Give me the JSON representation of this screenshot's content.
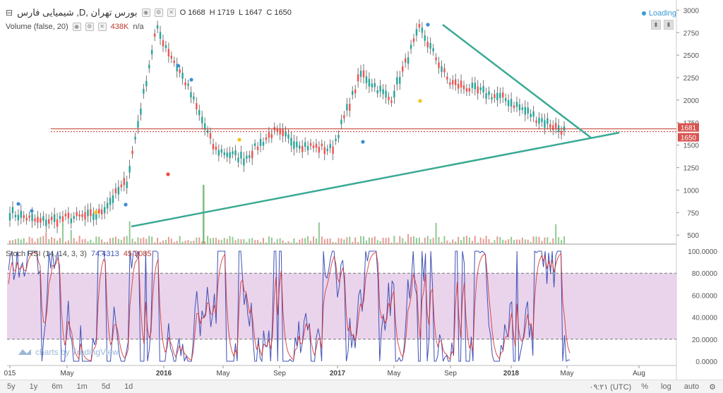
{
  "legend": {
    "symbol": "⊟",
    "title": "شیمیایی فارس ,D, بورس تهران",
    "open": "O 1668",
    "high": "H 1719",
    "low": "L 1647",
    "close": "C 1650"
  },
  "volume_legend": {
    "label": "Volume (false, 20)",
    "value": "438K",
    "na": "n/a"
  },
  "rsi_legend": {
    "label": "Stoch RSI (14, 14, 3, 3)",
    "k": "74.4313",
    "d": "45.3085"
  },
  "status": {
    "loading": "Loading"
  },
  "price_axis": {
    "ticks": [
      "3000",
      "2750",
      "2500",
      "2250",
      "2000",
      "1750",
      "1500",
      "1250",
      "1000",
      "750",
      "500"
    ],
    "badge_high": "1681",
    "badge_close": "1650"
  },
  "rsi_axis": {
    "ticks": [
      "100.0000",
      "80.0000",
      "60.0000",
      "40.0000",
      "20.0000",
      "0.0000"
    ]
  },
  "time_axis": {
    "labels": [
      "015",
      "May",
      "2016",
      "May",
      "Sep",
      "2017",
      "May",
      "Sep",
      "2018",
      "May",
      "Aug"
    ]
  },
  "bottom_bar": {
    "intervals": [
      "5y",
      "1y",
      "6m",
      "1m",
      "5d",
      "1d"
    ],
    "clock": "۰۹:۲۱ (UTC)",
    "right": [
      "%",
      "log",
      "auto"
    ]
  },
  "watermark": "charts by TradingView",
  "colors": {
    "up": "#26a69a",
    "down": "#ef5350",
    "trend": "#3aaa94",
    "stoch_k": "#3f51b5",
    "stoch_d": "#d32f2f",
    "band": "#e3c6e6",
    "hline": "#c0392b"
  },
  "chart_data": {
    "type": "line",
    "title": "",
    "price_axis_range": [
      400,
      3050
    ],
    "x": [
      "2015-01",
      "2015-05",
      "2015-09",
      "2015-11",
      "2016-01",
      "2016-02",
      "2016-04",
      "2016-06",
      "2016-08",
      "2016-10",
      "2016-12",
      "2017-02",
      "2017-04",
      "2017-06",
      "2017-07",
      "2017-09",
      "2017-11",
      "2018-01",
      "2018-03",
      "2018-04"
    ],
    "series": [
      {
        "values": [
          750,
          650,
          690,
          720,
          1100,
          2800,
          2200,
          1450,
          1350,
          1650,
          1500,
          1450,
          2300,
          2000,
          2800,
          2200,
          2100,
          2000,
          1800,
          1650
        ]
      }
    ],
    "horizontal_levels": [
      1681,
      1650
    ]
  }
}
